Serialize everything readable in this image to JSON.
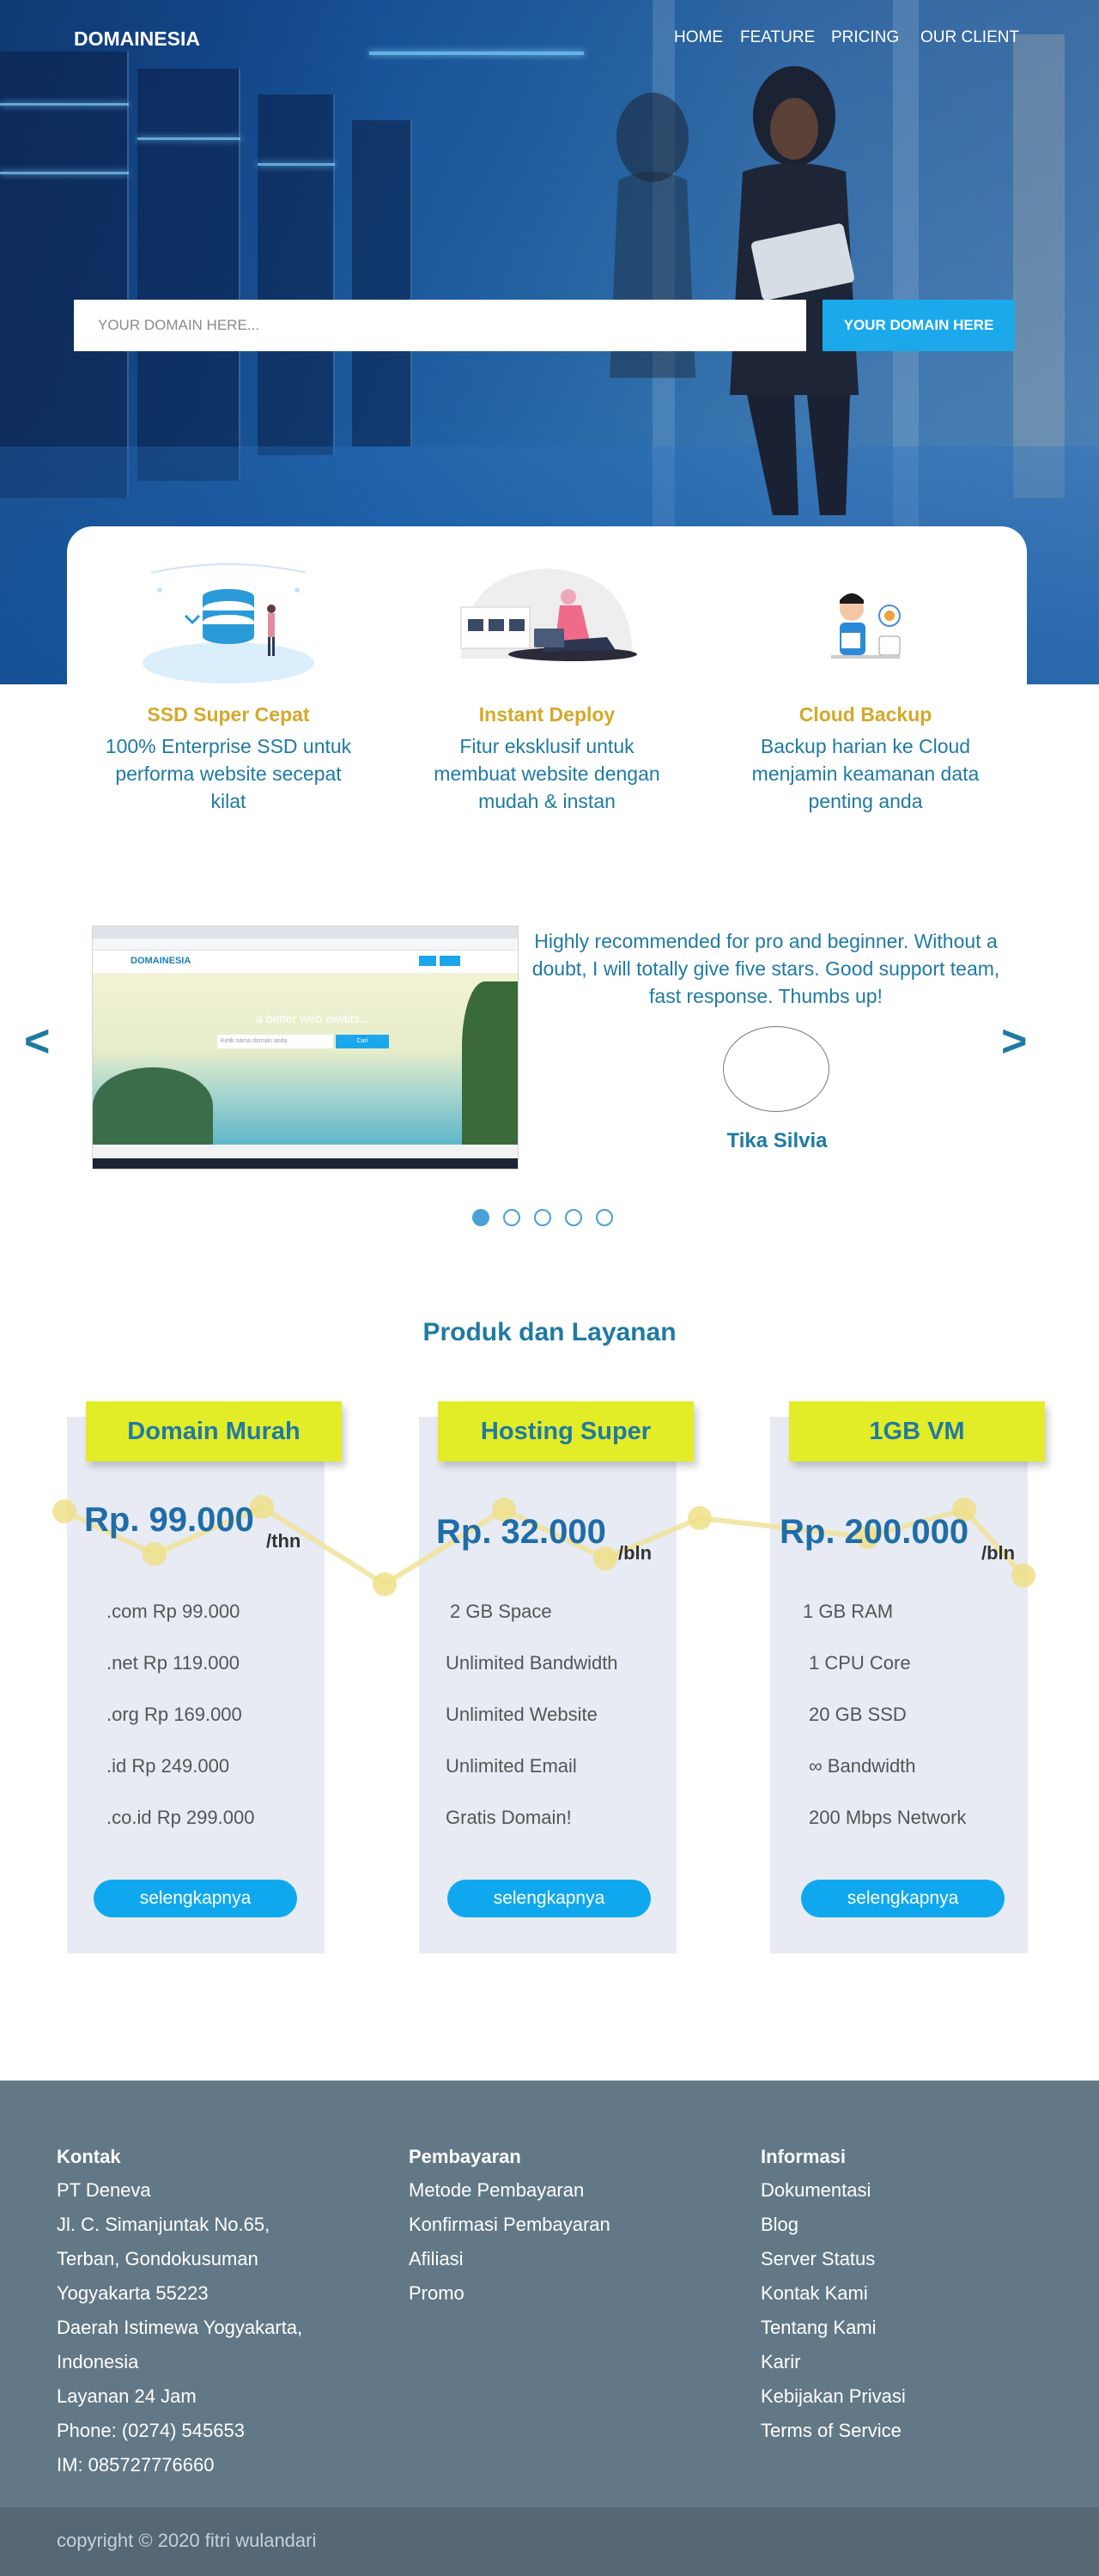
{
  "header": {
    "brand": "DOMAINESIA",
    "nav": [
      "HOME",
      "FEATURE",
      "PRICING",
      "OUR CLIENT"
    ]
  },
  "search": {
    "placeholder": "YOUR DOMAIN HERE...",
    "button_label": "YOUR DOMAIN HERE"
  },
  "features": [
    {
      "title": "SSD Super Cepat",
      "desc": "100% Enterprise SSD untuk performa website secepat kilat",
      "icon": "database-icon"
    },
    {
      "title": "Instant Deploy",
      "desc": "Fitur eksklusif untuk membuat website dengan mudah & instan",
      "icon": "laptop-user-icon"
    },
    {
      "title": "Cloud Backup",
      "desc": "Backup harian ke Cloud menjamin keamanan data penting anda",
      "icon": "cloud-backup-icon"
    }
  ],
  "testimonial": {
    "prev": "<",
    "next": ">",
    "quote": "Highly recommended for pro and beginner. Without a doubt, I will totally give five stars. Good support team, fast response. Thumbs up!",
    "name": "Tika Silvia",
    "screenshot": {
      "hero_text": "a better web awaits...",
      "search_placeholder": "Ketik nama domain anda",
      "search_button": "Cari"
    },
    "slides": 5,
    "active_slide": 1
  },
  "products": {
    "title": "Produk dan Layanan",
    "plans": [
      {
        "name": "Domain Murah",
        "price": "Rp. 99.000",
        "period": "/thn",
        "items": [
          ".com Rp 99.000",
          ".net Rp 119.000",
          ".org Rp 169.000",
          ".id Rp 249.000",
          ".co.id Rp 299.000"
        ],
        "button": "selengkapnya"
      },
      {
        "name": "Hosting Super",
        "price": "Rp. 32.000",
        "period": "/bln",
        "items": [
          "2 GB Space",
          "Unlimited Bandwidth",
          "Unlimited Website",
          "Unlimited Email",
          "Gratis Domain!"
        ],
        "button": "selengkapnya"
      },
      {
        "name": "1GB VM",
        "price": "Rp. 200.000",
        "period": "/bln",
        "items": [
          "1 GB RAM",
          "1 CPU Core",
          "20 GB SSD",
          "∞ Bandwidth",
          "200 Mbps Network"
        ],
        "button": "selengkapnya"
      }
    ]
  },
  "footer": {
    "columns": [
      {
        "title": "Kontak",
        "lines": [
          "PT Deneva",
          "Jl. C. Simanjuntak No.65,",
          "Terban, Gondokusuman",
          "Yogyakarta 55223",
          "Daerah Istimewa Yogyakarta,",
          "Indonesia",
          "Layanan 24 Jam",
          "Phone: (0274) 545653",
          "IM: 085727776660"
        ]
      },
      {
        "title": "Pembayaran",
        "lines": [
          "Metode Pembayaran",
          "Konfirmasi Pembayaran",
          "Afiliasi",
          "Promo"
        ]
      },
      {
        "title": "Informasi",
        "lines": [
          "Dokumentasi",
          "Blog",
          "Server Status",
          "Kontak Kami",
          "Tentang Kami",
          "Karir",
          "Kebijakan Privasi",
          "Terms of Service"
        ]
      }
    ],
    "copyright": "copyright © 2020 fitri wulandari"
  },
  "colors": {
    "accent": "#1ba9ec",
    "feature_title": "#d4a82a",
    "text_blue": "#1f7aa3",
    "tag_yellow": "#e3ed27",
    "footer_bg": "#637886"
  }
}
